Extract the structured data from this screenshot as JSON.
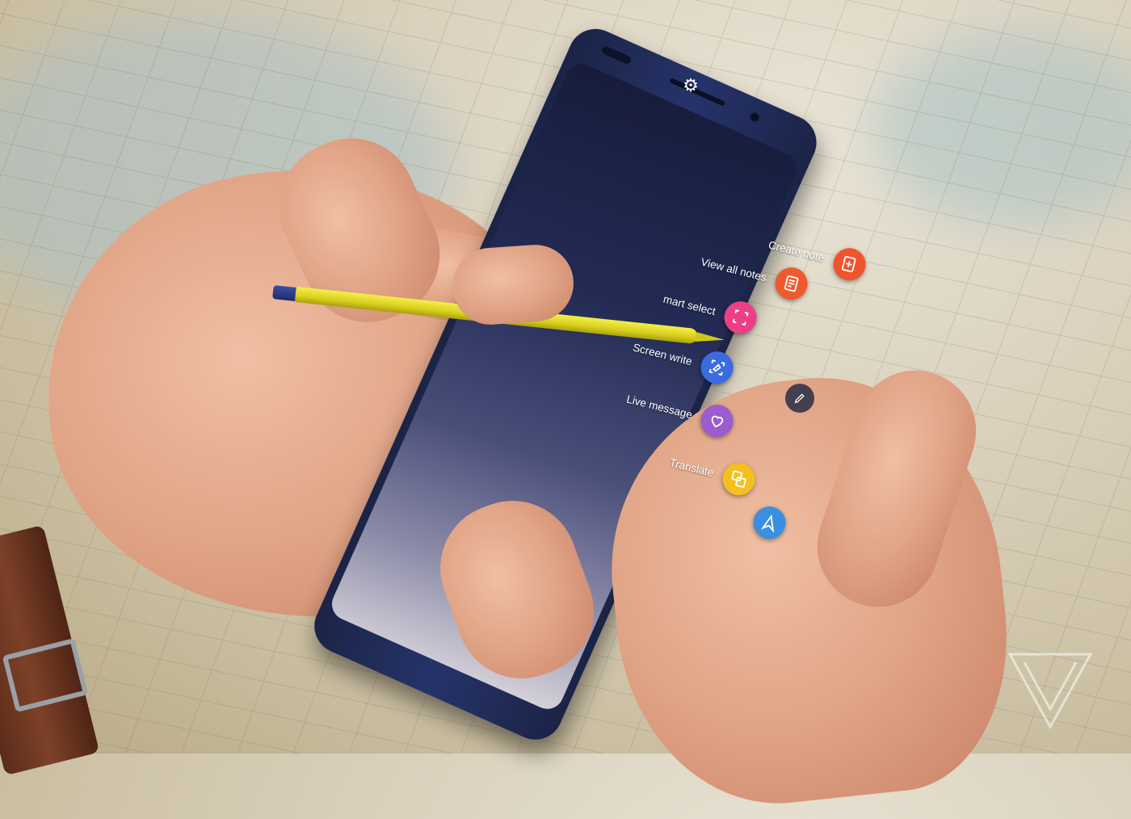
{
  "scene": {
    "description_role": "photo of a phone with stylus",
    "colors": {
      "pen_yellow": "#e8df2a",
      "phone_blue": "#22306a",
      "create_note": "#f0542d",
      "view_all_notes": "#ee5a2f",
      "smart_select": "#ec3f86",
      "screen_write": "#3c6ae0",
      "live_message": "#9a5ccf",
      "translate": "#f5bf1f",
      "bixby_vision": "#3a8fe0"
    }
  },
  "air_command": {
    "settings_icon": "gear-icon",
    "items": [
      {
        "label": "Create note",
        "icon": "create-note-icon"
      },
      {
        "label": "View all notes",
        "icon": "view-notes-icon"
      },
      {
        "label": "mart select",
        "icon": "smart-select-icon"
      },
      {
        "label": "Screen write",
        "icon": "screen-write-icon"
      },
      {
        "label": "Live message",
        "icon": "live-message-icon"
      },
      {
        "label": "Translate",
        "icon": "translate-icon"
      },
      {
        "label": "",
        "icon": "paper-plane-icon"
      }
    ],
    "pen_bubble_icon": "pen-icon"
  }
}
